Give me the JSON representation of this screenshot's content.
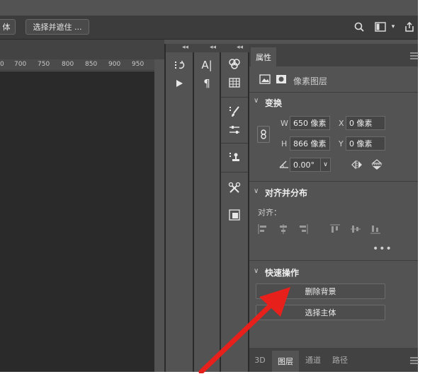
{
  "options_bar": {
    "partial_button_label": "体",
    "select_mask_label": "选择并遮住 ..."
  },
  "icons": {
    "search": "search-icon",
    "frame": "frame-icon",
    "share": "share-icon"
  },
  "ruler": {
    "ticks": [
      "0",
      "700",
      "750",
      "800",
      "850",
      "900",
      "950"
    ]
  },
  "panel": {
    "tab_label": "属性",
    "layer_type": "像素图层",
    "transform": {
      "title": "变换",
      "w_label": "W",
      "w_value": "650 像素",
      "x_label": "X",
      "x_value": "0 像素",
      "h_label": "H",
      "h_value": "866 像素",
      "y_label": "Y",
      "y_value": "0 像素",
      "angle_value": "0.00°"
    },
    "align": {
      "title": "对齐并分布",
      "label": "对齐："
    },
    "quick_actions": {
      "title": "快速操作",
      "remove_bg": "删除背景",
      "select_subject": "选择主体"
    }
  },
  "bottom_tabs": [
    "3D",
    "图层",
    "通道",
    "路径"
  ],
  "colors": {
    "panel_bg": "#535353",
    "canvas_bg": "#2a2a2a",
    "arrow": "#e8201c"
  }
}
